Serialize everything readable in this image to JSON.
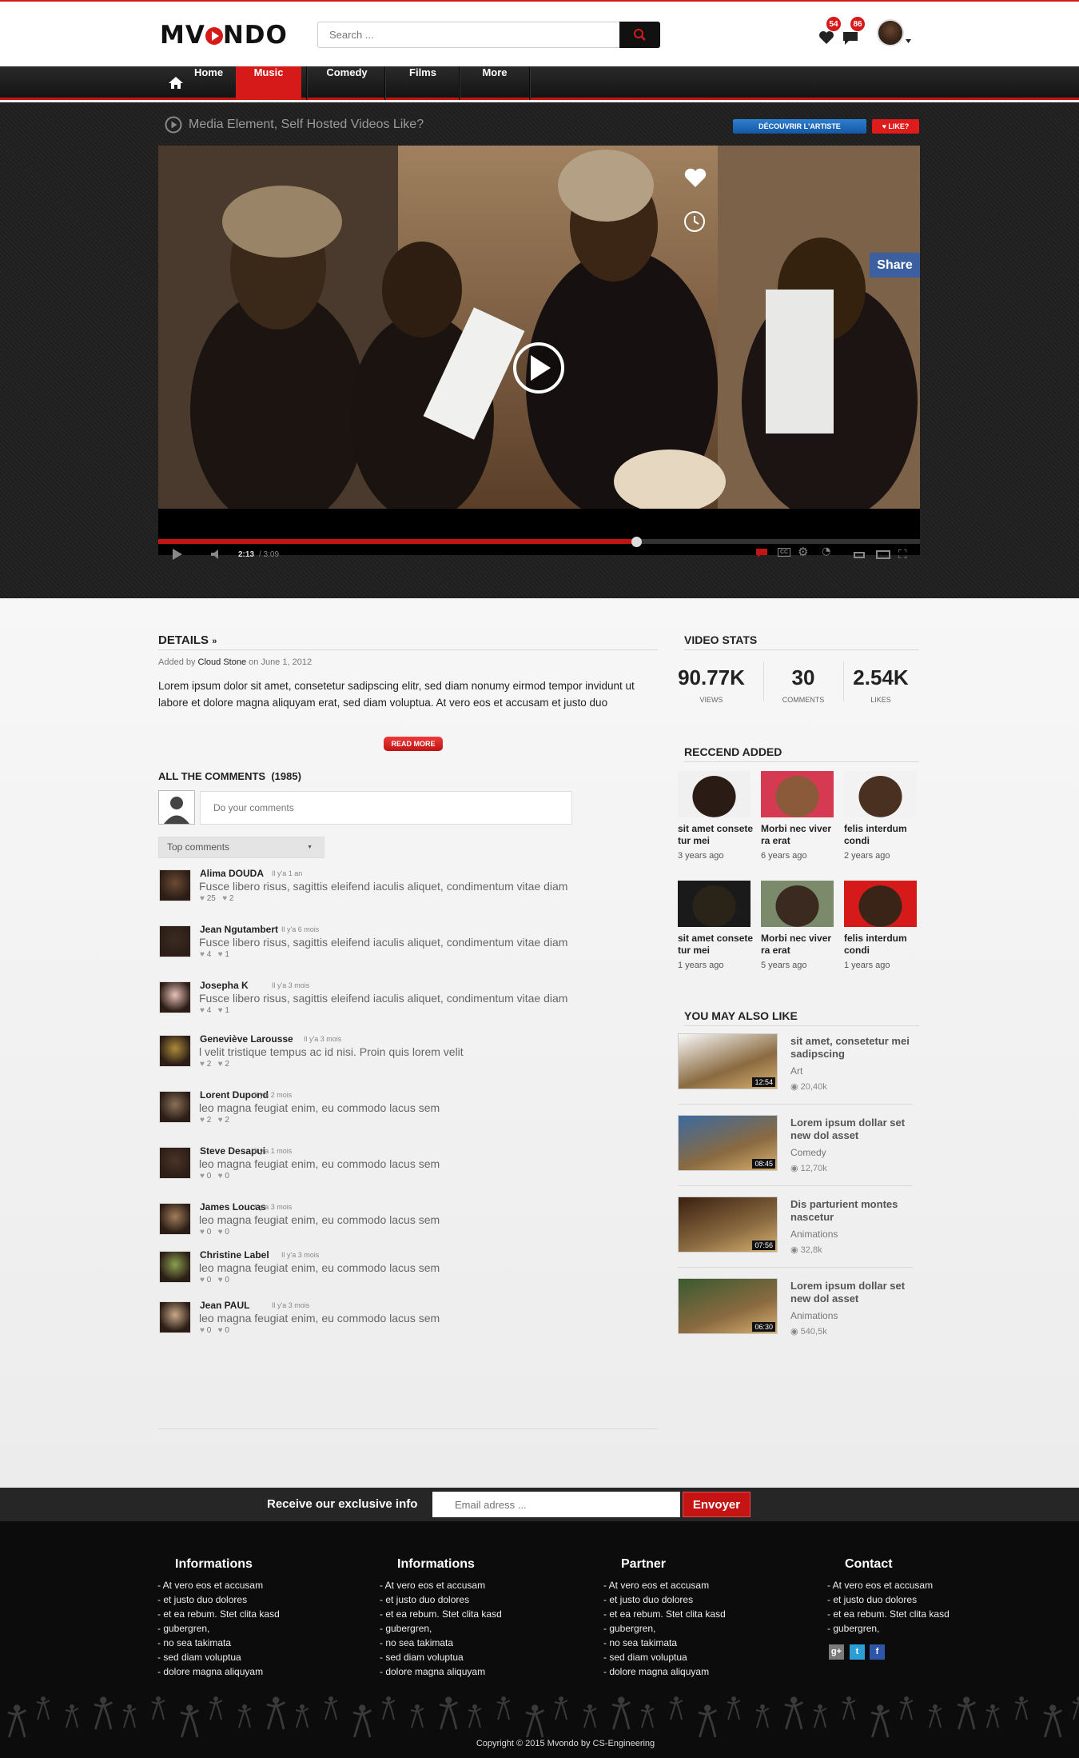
{
  "header": {
    "logo": "MVONDO",
    "search_placeholder": "Search ...",
    "notifications_count": "54",
    "messages_count": "86"
  },
  "nav": {
    "items": [
      "Home",
      "Music",
      "Comedy",
      "Films",
      "More"
    ],
    "active": "Music"
  },
  "video": {
    "title": "Media Element, Self Hosted Videos Like?",
    "discover_label": "DÉCOUVRIR L'ARTISTE",
    "like_label": "LIKE?",
    "share_label": "Share",
    "current_time": "2:13",
    "duration": "/ 3:09",
    "progress": 0.628
  },
  "details": {
    "heading": "DETAILS",
    "added_by_prefix": "Added by",
    "author": "Cloud Stone",
    "date": "on June 1, 2012",
    "description": "Lorem ipsum dolor sit amet, consetetur sadipscing elitr, sed diam nonumy eirmod tempor invidunt ut labore et dolore magna aliquyam erat, sed diam voluptua. At vero eos et accusam et justo duo",
    "read_more": "READ MORE"
  },
  "comments": {
    "heading": "ALL THE COMMENTS",
    "count": "(1985)",
    "input_placeholder": "Do your comments",
    "sort_selected": "Top comments",
    "list": [
      {
        "name": "Alima DOUDA",
        "time": "Il y'a 1 an",
        "text": "Fusce libero risus, sagittis eleifend iaculis aliquet, condimentum vitae diam",
        "likes": "25",
        "dislikes": "2"
      },
      {
        "name": "Jean Ngutambert",
        "time": "Il y'a 6 mois",
        "text": "Fusce libero risus, sagittis eleifend iaculis aliquet, condimentum vitae diam",
        "likes": "4",
        "dislikes": "1"
      },
      {
        "name": "Josepha K",
        "time": "Il y'a 3 mois",
        "text": "Fusce libero risus, sagittis eleifend iaculis aliquet, condimentum vitae diam",
        "likes": "4",
        "dislikes": "1"
      },
      {
        "name": "Geneviève Larousse",
        "time": "Il y'a 3 mois",
        "text": "l velit tristique tempus ac id nisi. Proin quis lorem velit",
        "likes": "2",
        "dislikes": "2"
      },
      {
        "name": "Lorent Dupond",
        "time": "Il y'a 2 mois",
        "text": "leo magna feugiat enim, eu commodo lacus sem",
        "likes": "2",
        "dislikes": "2"
      },
      {
        "name": "Steve Desapui",
        "time": "Il y'a 1 mois",
        "text": "leo magna feugiat enim, eu commodo lacus sem",
        "likes": "0",
        "dislikes": "0"
      },
      {
        "name": "James Loucas",
        "time": "Il y'a 3 mois",
        "text": "leo magna feugiat enim, eu commodo lacus sem",
        "likes": "0",
        "dislikes": "0"
      },
      {
        "name": "Christine Label",
        "time": "Il y'a 3 mois",
        "text": "leo magna feugiat enim, eu commodo lacus sem",
        "likes": "0",
        "dislikes": "0"
      },
      {
        "name": "Jean PAUL",
        "time": "Il y'a 3 mois",
        "text": "leo magna feugiat enim, eu commodo lacus sem",
        "likes": "0",
        "dislikes": "0"
      }
    ]
  },
  "stats": {
    "heading": "VIDEO STATS",
    "items": [
      {
        "value": "90.77K",
        "label": "VIEWS"
      },
      {
        "value": "30",
        "label": "COMMENTS"
      },
      {
        "value": "2.54K",
        "label": "LIKES"
      }
    ]
  },
  "recent": {
    "heading": "RECCEND ADDED",
    "items": [
      {
        "title": "sit amet consete tur mei",
        "time": "3 years ago"
      },
      {
        "title": "Morbi nec viver ra erat",
        "time": "6 years ago"
      },
      {
        "title": "felis interdum condi",
        "time": "2 years ago"
      },
      {
        "title": "sit amet consete tur mei",
        "time": "1 years ago"
      },
      {
        "title": "Morbi nec viver ra erat",
        "time": "5 years ago"
      },
      {
        "title": "felis interdum condi",
        "time": "1 years ago"
      }
    ]
  },
  "also_like": {
    "heading": "YOU MAY ALSO LIKE",
    "items": [
      {
        "title": "sit amet, consetetur mei sadipscing",
        "category": "Art",
        "views": "20,40k",
        "duration": "12:54"
      },
      {
        "title": "Lorem ipsum dollar set new dol asset",
        "category": "Comedy",
        "views": "12,70k",
        "duration": "08:45"
      },
      {
        "title": "Dis parturient montes nascetur",
        "category": "Animations",
        "views": "32,8k",
        "duration": "07:56"
      },
      {
        "title": "Lorem ipsum dollar set new dol asset",
        "category": "Animations",
        "views": "540,5k",
        "duration": "06:30"
      }
    ]
  },
  "newsletter": {
    "label": "Receive our exclusive info",
    "placeholder": "Email adress ...",
    "button": "Envoyer"
  },
  "footer": {
    "columns": [
      {
        "heading": "Informations",
        "links": [
          "- At vero eos et accusam",
          "- et justo duo dolores",
          "- et ea rebum. Stet clita kasd",
          "- gubergren,",
          "- no sea takimata",
          "- sed diam voluptua",
          "- dolore magna aliquyam"
        ]
      },
      {
        "heading": "Informations",
        "links": [
          "- At vero eos et accusam",
          "- et justo duo dolores",
          "- et ea rebum. Stet clita kasd",
          "- gubergren,",
          "- no sea takimata",
          "- sed diam voluptua",
          "- dolore magna aliquyam"
        ]
      },
      {
        "heading": "Partner",
        "links": [
          "- At vero eos et accusam",
          "- et justo duo dolores",
          "- et ea rebum. Stet clita kasd",
          "- gubergren,",
          "- no sea takimata",
          "- sed diam voluptua",
          "- dolore magna aliquyam"
        ]
      },
      {
        "heading": "Contact",
        "links": [
          "- At vero eos et accusam",
          "- et justo duo dolores",
          "- et ea rebum. Stet clita kasd",
          "- gubergren,"
        ]
      }
    ],
    "social": [
      "g+",
      "t",
      "f"
    ],
    "copyright": "Copyright © 2015 Mvondo by CS-Engineering"
  },
  "colors": {
    "accent": "#d61a1a",
    "dark": "#1a1a1a",
    "blue": "#1e6bbf"
  }
}
